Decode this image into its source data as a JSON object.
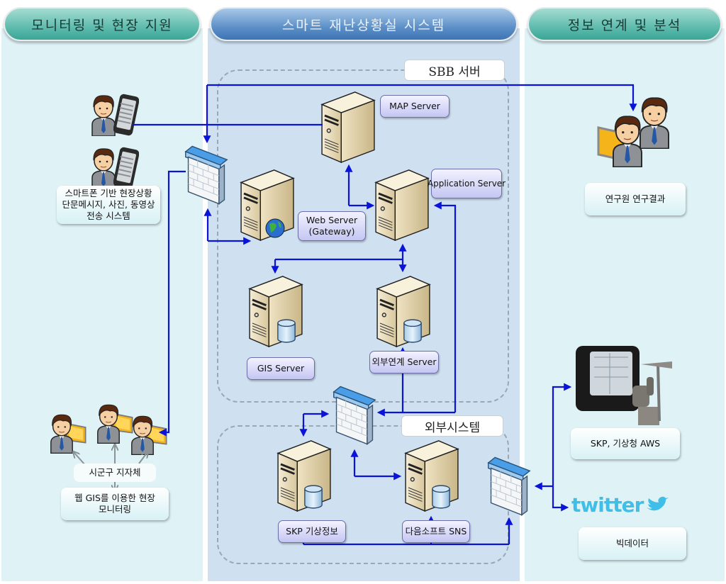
{
  "headers": {
    "left": "모니터링 및 현장 지원",
    "middle": "스마트 재난상황실 시스템",
    "right": "정보 연계 및 분석"
  },
  "groups": {
    "sbb": "SBB  서버",
    "external": "외부시스템"
  },
  "servers": {
    "map": "MAP Server",
    "application": "Application Server",
    "web_line1": "Web Server",
    "web_line2": "(Gateway)",
    "gis": "GIS Server",
    "external_link": "외부연계 Server",
    "skp_weather": "SKP 기상정보",
    "daum_sns": "다음소프트 SNS"
  },
  "left_panel": {
    "smartphone_line1": "스마트폰 기반 현장상황",
    "smartphone_line2": "단문메시지, 사진, 동영상",
    "smartphone_line3": "전송 시스템",
    "local_gov": "시군구 지자체",
    "webgis_line1": "웹 GIS를 이용한 현장",
    "webgis_line2": "모니터링"
  },
  "right_panel": {
    "research": "연구원 연구결과",
    "aws": "SKP, 기상청 AWS",
    "twitter_logo": "twitter",
    "bigdata": "빅데이터"
  },
  "colors": {
    "connector": "#0a14d8",
    "teal_header": "#4fb3a5",
    "blue_header": "#4a82c0",
    "twitter": "#3fbfe8"
  }
}
